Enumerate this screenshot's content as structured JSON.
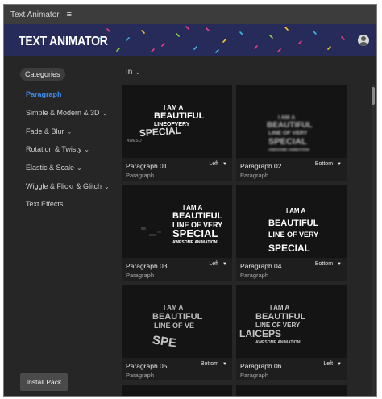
{
  "titlebar": {
    "title": "Text Animator",
    "menu_icon": "hamburger-menu-icon"
  },
  "banner": {
    "brand": "TEXT ANIMATOR",
    "avatar_icon": "user-avatar-icon",
    "accent_color": "#272b5a"
  },
  "sidebar": {
    "categories_label": "Categories",
    "items": [
      {
        "label": "Paragraph",
        "active": true,
        "has_chevron": false
      },
      {
        "label": "Simple & Modern & 3D",
        "active": false,
        "has_chevron": true
      },
      {
        "label": "Fade & Blur",
        "active": false,
        "has_chevron": true
      },
      {
        "label": "Rotation & Twisty",
        "active": false,
        "has_chevron": true
      },
      {
        "label": "Elastic & Scale",
        "active": false,
        "has_chevron": true
      },
      {
        "label": "Wiggle & Flickr & Glitch",
        "active": false,
        "has_chevron": true
      },
      {
        "label": "Text Effects",
        "active": false,
        "has_chevron": false
      }
    ],
    "install_label": "Install Pack",
    "active_color": "#3d8ef0"
  },
  "main": {
    "filter_label": "In",
    "cards": [
      {
        "name": "Paragraph 01",
        "category": "Paragraph",
        "direction": "Left"
      },
      {
        "name": "Paragraph 02",
        "category": "Paragraph",
        "direction": "Bottom"
      },
      {
        "name": "Paragraph 03",
        "category": "Paragraph",
        "direction": "Left"
      },
      {
        "name": "Paragraph 04",
        "category": "Paragraph",
        "direction": "Bottom"
      },
      {
        "name": "Paragraph 05",
        "category": "Paragraph",
        "direction": "Bottom"
      },
      {
        "name": "Paragraph 06",
        "category": "Paragraph",
        "direction": "Left"
      }
    ],
    "preview_text": {
      "l1": "I AM A",
      "l2": "BEAUTIFUL",
      "l3": "LINE OF VERY",
      "l4": "SPECIAL",
      "l5": "AWESOME ANIMATION!",
      "l3_compact": "LINEOFVERY",
      "l5_short": "AWESO",
      "l3_cut": "LINE OF VE",
      "l4_cut": "SPE",
      "l4_mirror": "LAICEPS",
      "l4_small": "SPECIAL"
    }
  }
}
